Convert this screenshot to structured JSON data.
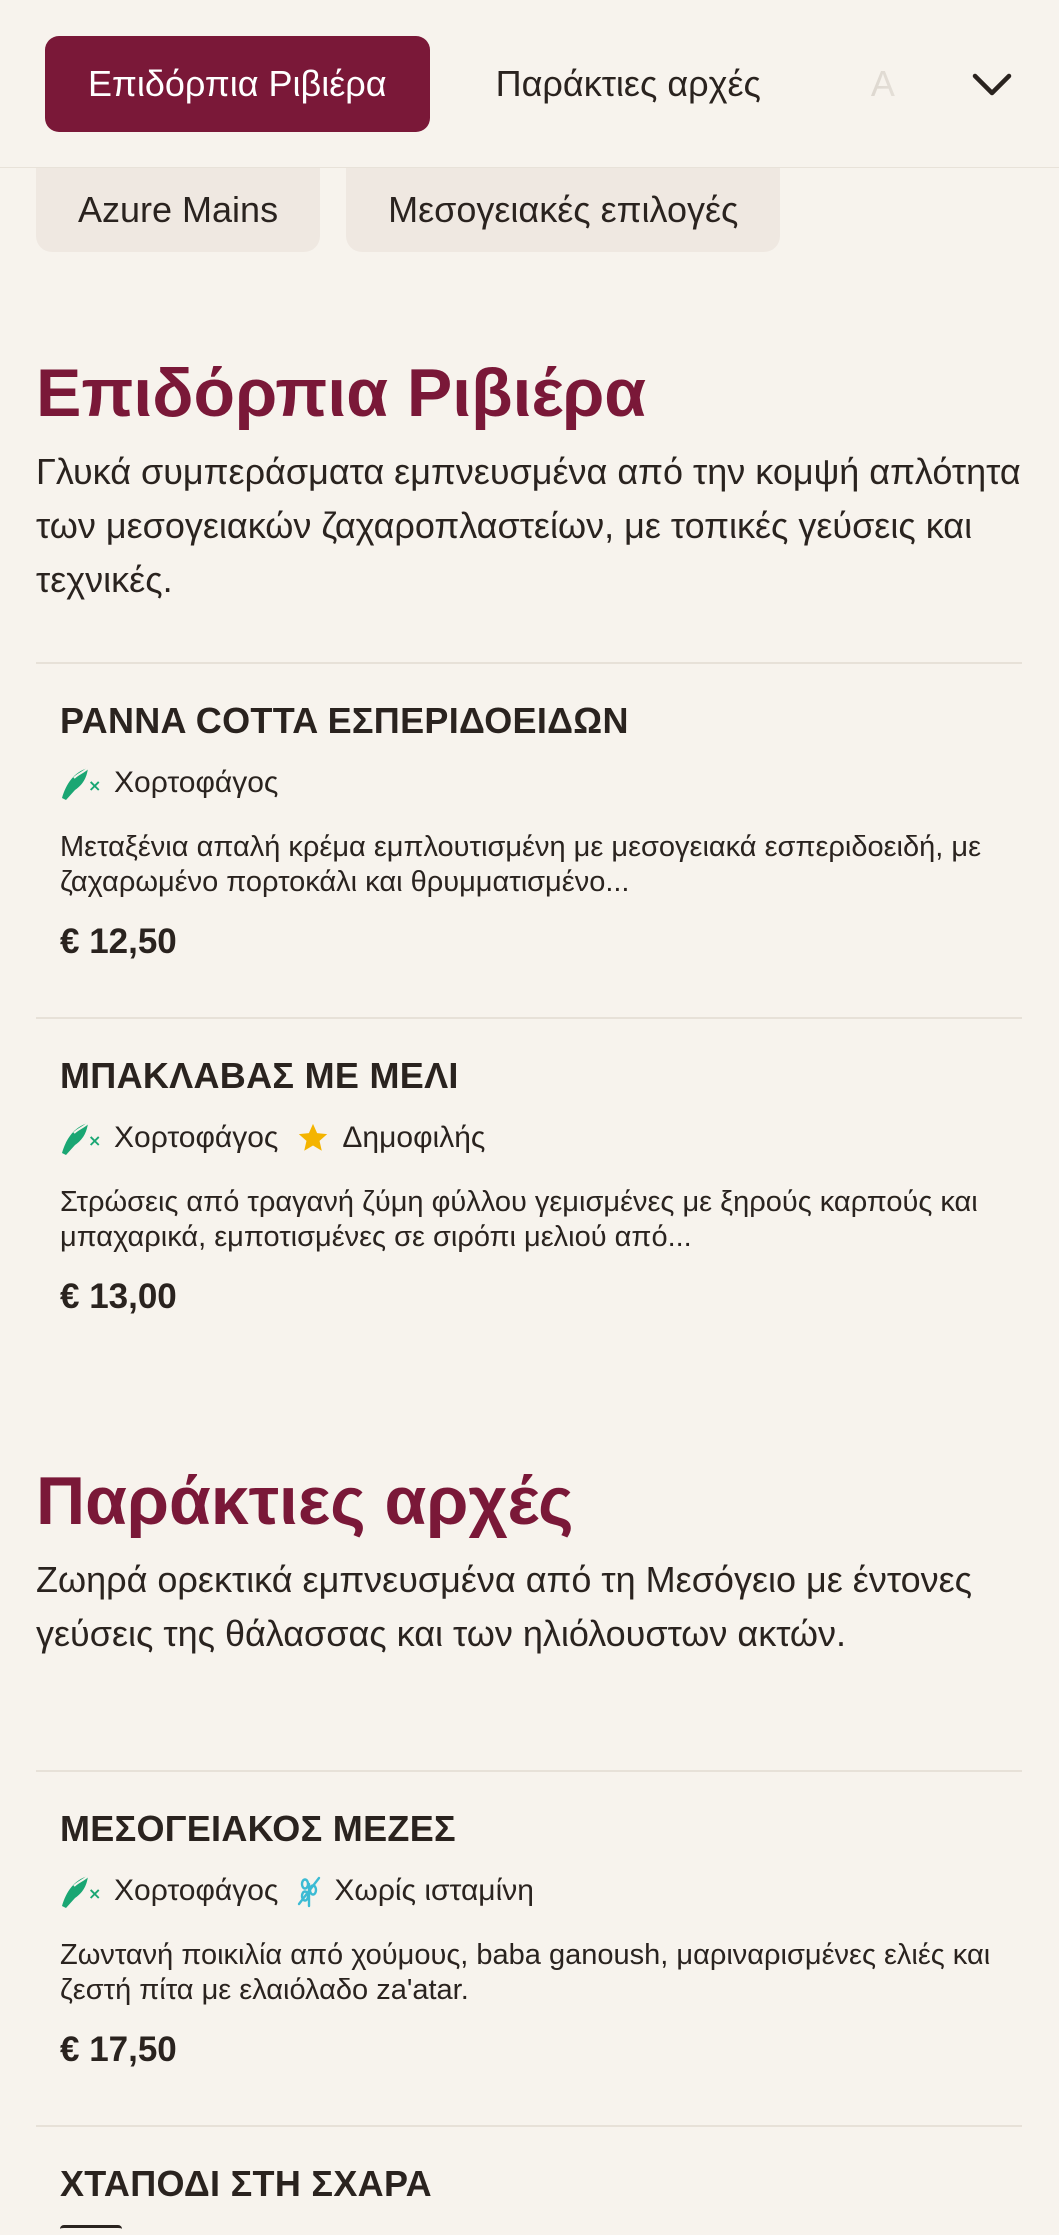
{
  "nav": {
    "tabs": [
      {
        "label": "Επιδόρπια Ριβιέρα",
        "active": true
      },
      {
        "label": "Παράκτιες αρχές",
        "active": false
      },
      {
        "label": "A",
        "active": false
      }
    ],
    "more_icon": "chevron-down-icon"
  },
  "subcategories": [
    {
      "label": "Azure Mains"
    },
    {
      "label": "Μεσογειακές επιλογές"
    }
  ],
  "colors": {
    "accent": "#7a1838",
    "vegetarian": "#1aa673",
    "popular": "#f4b400",
    "gluten_free": "#3cbbd4"
  },
  "sections": [
    {
      "title": "Επιδόρπια Ριβιέρα",
      "description": "Γλυκά συμπεράσματα εμπνευσμένα από την κομψή απλότητα των μεσογειακών ζαχαροπλαστείων, με τοπικές γεύσεις και τεχνικές.",
      "items": [
        {
          "name": "PANNA COTTA ΕΣΠΕΡΙΔΟΕΙΔΩΝ",
          "tags": [
            {
              "icon": "vegetarian-icon",
              "label": "Χορτοφάγος"
            }
          ],
          "description": "Μεταξένια απαλή κρέμα εμπλουτισμένη με μεσογειακά εσπεριδοειδή, με ζαχαρωμένο πορτοκάλι και θρυμματισμένο...",
          "price": "€ 12,50"
        },
        {
          "name": "ΜΠΑΚΛΑΒΑΣ ΜΕ ΜΕΛΙ",
          "tags": [
            {
              "icon": "vegetarian-icon",
              "label": "Χορτοφάγος"
            },
            {
              "icon": "star-icon",
              "label": "Δημοφιλής"
            }
          ],
          "description": "Στρώσεις από τραγανή ζύμη φύλλου γεμισμένες με ξηρούς καρπούς και μπαχαρικά, εμποτισμένες σε σιρόπι μελιού από...",
          "price": "€ 13,00"
        }
      ]
    },
    {
      "title": "Παράκτιες αρχές",
      "description": "Ζωηρά ορεκτικά εμπνευσμένα από τη Μεσόγειο με έντονες γεύσεις της θάλασσας και των ηλιόλουστων ακτών.",
      "items": [
        {
          "name": "ΜΕΣΟΓΕΙΑΚΟΣ ΜΕΖΕΣ",
          "tags": [
            {
              "icon": "vegetarian-icon",
              "label": "Χορτοφάγος"
            },
            {
              "icon": "gluten-free-icon",
              "label": "Χωρίς ισταμίνη"
            }
          ],
          "description": "Ζωντανή ποικιλία από χούμους, baba ganoush, μαριναρισμένες ελιές και ζεστή πίτα με ελαιόλαδο za'atar.",
          "price": "€ 17,50"
        },
        {
          "name": "ΧΤΑΠΟΔΙ ΣΤΗ ΣΧΑΡΑ"
        }
      ]
    }
  ]
}
